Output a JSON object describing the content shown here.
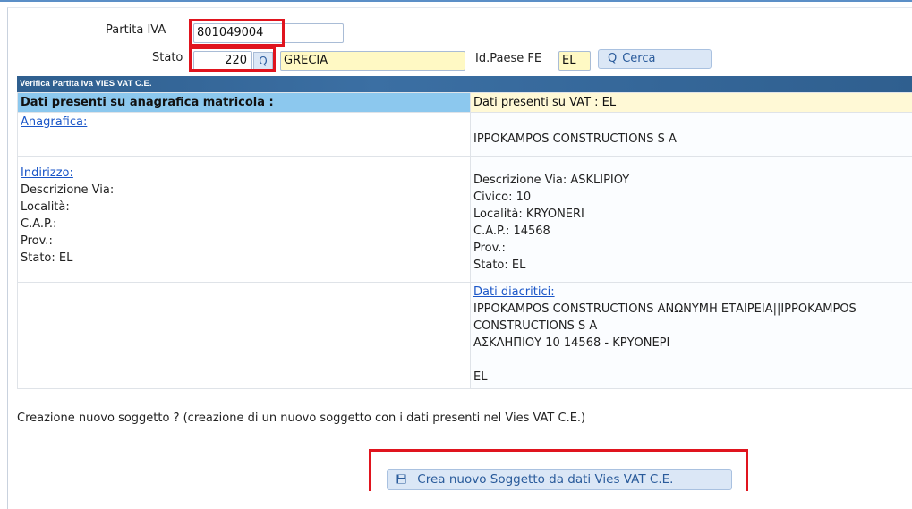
{
  "form": {
    "partita_iva_label": "Partita IVA",
    "partita_iva_value": "801049004",
    "stato_label": "Stato",
    "stato_code": "220",
    "stato_name": "GRECIA",
    "id_paese_label": "Id.Paese FE",
    "id_paese_value": "EL",
    "search_icon": "Q",
    "cerca_label": "Cerca"
  },
  "panel": {
    "title": "Verifica Partita Iva VIES VAT C.E.",
    "left_header": "Dati presenti su anagrafica matricola :",
    "right_header": "Dati presenti su VAT : EL"
  },
  "left": {
    "anagrafica_link": "Anagrafica:",
    "indirizzo_link": "Indirizzo:",
    "descrizione_via": "Descrizione Via:",
    "localita": "Località:",
    "cap": "C.A.P.:",
    "prov": "Prov.:",
    "stato": "Stato: EL"
  },
  "right": {
    "anagrafica_value": "IPPOKAMPOS CONSTRUCTIONS S A",
    "descrizione_via": "Descrizione Via: ASKLIPIOY",
    "civico": "Civico: 10",
    "localita": "Località: KRYONERI",
    "cap": "C.A.P.: 14568",
    "prov": "Prov.:",
    "stato": "Stato: EL",
    "diacritici_link": "Dati diacritici:",
    "diacritici_line1": "IPPOKAMPOS CONSTRUCTIONS ΑΝΩΝΥΜΗ ΕΤΑΙΡΕΙΑ||IPPOKAMPOS",
    "diacritici_line2": "CONSTRUCTIONS S A",
    "diacritici_line3": "ΑΣΚΛΗΠΙΟΥ 10 14568 - ΚΡΥΟΝΕΡΙ",
    "diacritici_line4": "EL"
  },
  "footer": {
    "question": "Creazione nuovo soggetto ? (creazione di un nuovo soggetto con i dati presenti nel Vies VAT C.E.)",
    "crea_label": "Crea nuovo Soggetto da dati Vies VAT C.E.",
    "save_icon": "floppy-disk-icon"
  },
  "colors": {
    "highlight_red": "#e0141e",
    "panel_header": "#2f5f8f",
    "left_header_bg": "#8cc8ee",
    "right_header_bg": "#fff9d6",
    "input_yellow": "#fff9c4"
  }
}
